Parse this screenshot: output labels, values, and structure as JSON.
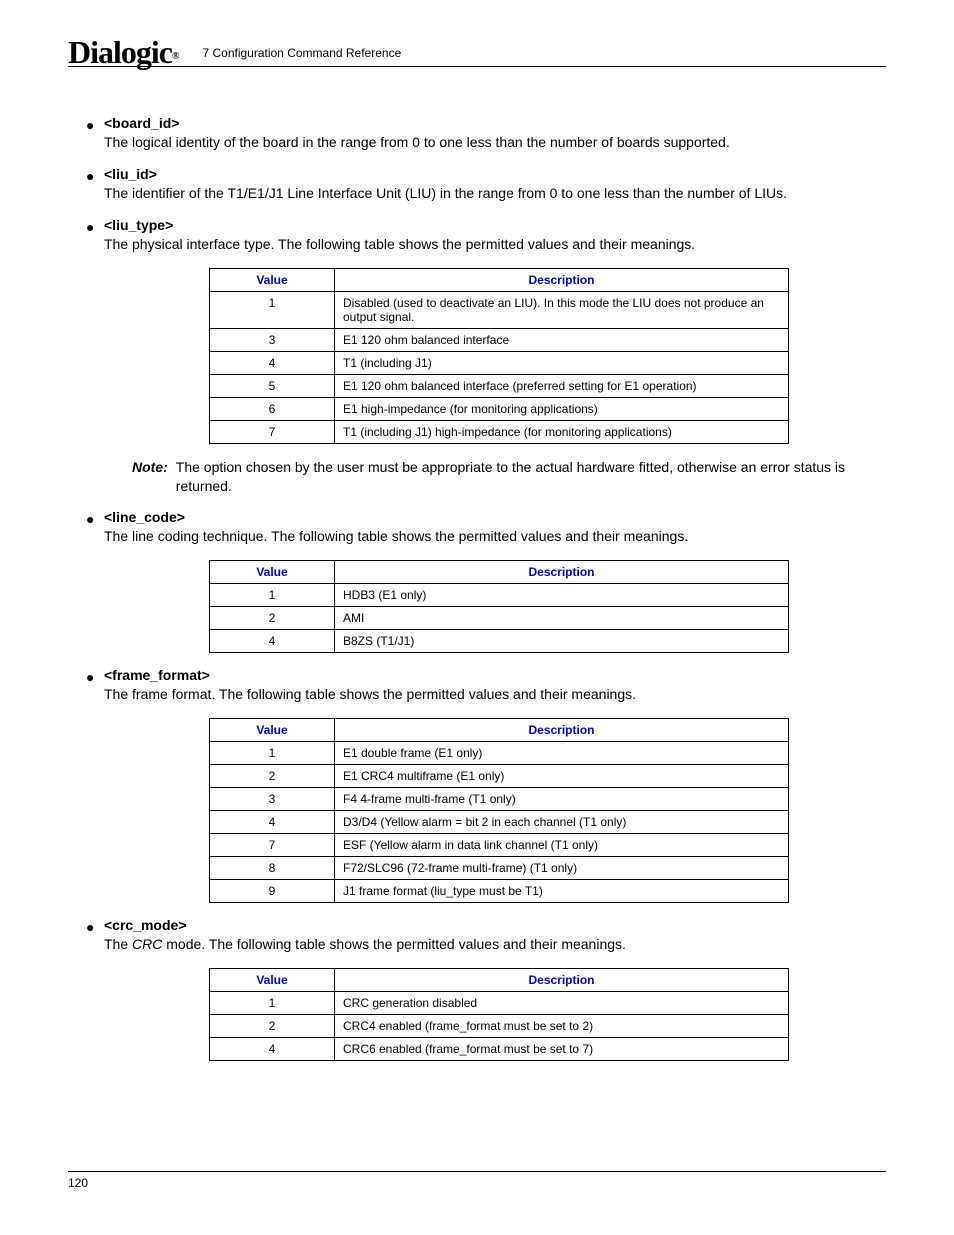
{
  "header": {
    "logo_text": "Dialogic",
    "section": "7 Configuration Command Reference"
  },
  "params": {
    "board_id": {
      "title": "<board_id>",
      "body": "The logical identity of the board in the range from 0 to one less than the number of boards supported."
    },
    "liu_id": {
      "title": "<liu_id>",
      "body": "The identifier of the T1/E1/J1 Line Interface Unit (LIU) in the range from 0 to one less than the number of LIUs."
    },
    "liu_type": {
      "title": "<liu_type>",
      "body": "The physical interface type. The following table shows the permitted values and their meanings."
    },
    "line_code": {
      "title": "<line_code>",
      "body": "The line coding technique. The following table shows the permitted values and their meanings."
    },
    "frame_format": {
      "title": "<frame_format>",
      "body": "The frame format. The following table shows the permitted values and their meanings."
    },
    "crc_mode": {
      "title": "<crc_mode>",
      "body_prefix": "The ",
      "body_italic": "CRC",
      "body_suffix": " mode. The following table shows the permitted values and their meanings."
    }
  },
  "tables": {
    "headers": {
      "value": "Value",
      "description": "Description"
    },
    "liu_type": [
      {
        "v": "1",
        "d": "Disabled (used to deactivate an LIU). In this mode the LIU does not produce an output signal."
      },
      {
        "v": "3",
        "d": "E1 120 ohm balanced interface"
      },
      {
        "v": "4",
        "d": "T1 (including J1)"
      },
      {
        "v": "5",
        "d": "E1 120 ohm balanced interface (preferred setting for E1 operation)"
      },
      {
        "v": "6",
        "d": "E1 high-impedance (for monitoring applications)"
      },
      {
        "v": "7",
        "d": "T1 (including J1) high-impedance (for monitoring applications)"
      }
    ],
    "line_code": [
      {
        "v": "1",
        "d": "HDB3 (E1 only)"
      },
      {
        "v": "2",
        "d": "AMI"
      },
      {
        "v": "4",
        "d": "B8ZS (T1/J1)"
      }
    ],
    "frame_format": [
      {
        "v": "1",
        "d": "E1 double frame (E1 only)"
      },
      {
        "v": "2",
        "d": "E1 CRC4 multiframe (E1 only)"
      },
      {
        "v": "3",
        "d": "F4 4-frame multi-frame (T1 only)"
      },
      {
        "v": "4",
        "d": "D3/D4 (Yellow alarm = bit 2 in each channel (T1 only)"
      },
      {
        "v": "7",
        "d": "ESF (Yellow alarm in data link channel (T1 only)"
      },
      {
        "v": "8",
        "d": "F72/SLC96 (72-frame multi-frame) (T1 only)"
      },
      {
        "v": "9",
        "d": "J1 frame format (liu_type must be T1)"
      }
    ],
    "crc_mode": [
      {
        "v": "1",
        "d": "CRC generation disabled"
      },
      {
        "v": "2",
        "d": "CRC4 enabled (frame_format must be set to 2)"
      },
      {
        "v": "4",
        "d": "CRC6 enabled (frame_format must be set to 7)"
      }
    ]
  },
  "note": {
    "label": "Note:",
    "text": "The option chosen by the user must be appropriate to the actual hardware fitted, otherwise an error status is returned."
  },
  "footer": {
    "page_number": "120"
  }
}
